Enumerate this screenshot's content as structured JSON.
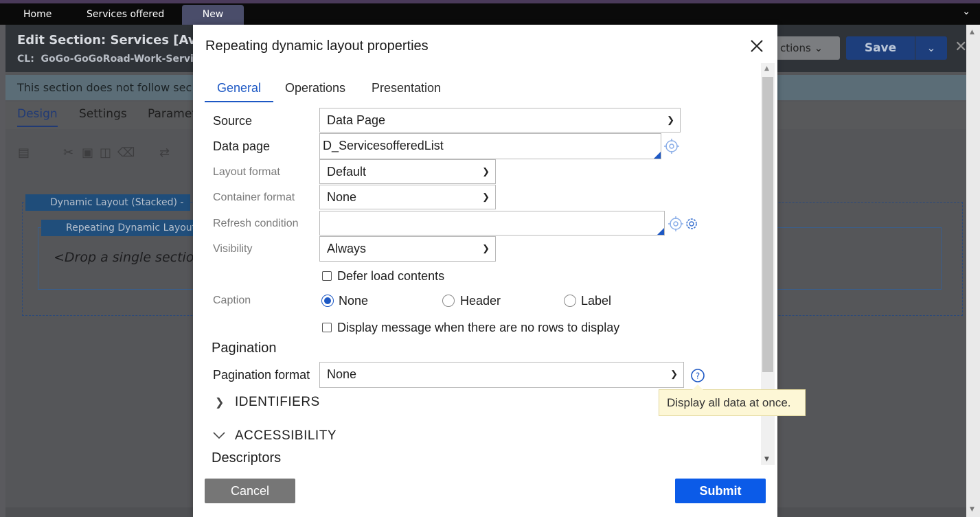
{
  "topbar": {
    "tabs": [
      {
        "label": "Home"
      },
      {
        "label": "Services offered"
      },
      {
        "label": "New"
      }
    ]
  },
  "background": {
    "title": "Edit  Section: Services [Availa",
    "class_label": "CL:",
    "class_value": "GoGo-GoGoRoad-Work-Servic",
    "actions_label": "ctions",
    "save_label": "Save",
    "banner": "This section does not follow sec",
    "tabs": [
      "Design",
      "Settings",
      "Paramet"
    ],
    "dynamic_layout": "Dynamic Layout (Stacked) -",
    "repeating_layout": "Repeating Dynamic Layout",
    "drop_text": "<Drop a single section"
  },
  "modal": {
    "title": "Repeating dynamic layout properties",
    "tabs": [
      "General",
      "Operations",
      "Presentation"
    ],
    "source": {
      "label": "Source",
      "value": "Data Page"
    },
    "data_page": {
      "label": "Data page",
      "value": "D_ServicesofferedList"
    },
    "layout_format": {
      "label": "Layout format",
      "value": "Default"
    },
    "container_format": {
      "label": "Container format",
      "value": "None"
    },
    "refresh_condition": {
      "label": "Refresh condition",
      "value": ""
    },
    "visibility": {
      "label": "Visibility",
      "value": "Always"
    },
    "defer_load": {
      "label": "Defer load contents",
      "checked": false
    },
    "caption": {
      "label": "Caption",
      "options": [
        "None",
        "Header",
        "Label"
      ],
      "selected": "None"
    },
    "no_rows_message": {
      "label": "Display message when there are no rows to display",
      "checked": false
    },
    "pagination": {
      "heading": "Pagination",
      "format_label": "Pagination format",
      "format_value": "None",
      "tooltip": "Display all data at once."
    },
    "identifiers": {
      "label": "IDENTIFIERS",
      "expanded": false
    },
    "accessibility": {
      "label": "ACCESSIBILITY",
      "expanded": true
    },
    "descriptors": "Descriptors",
    "cancel_label": "Cancel",
    "submit_label": "Submit"
  },
  "colors": {
    "accent": "#1d58c4",
    "submit": "#0b5be8",
    "cancel": "#767676",
    "tooltip_bg": "#fdf7d6"
  }
}
